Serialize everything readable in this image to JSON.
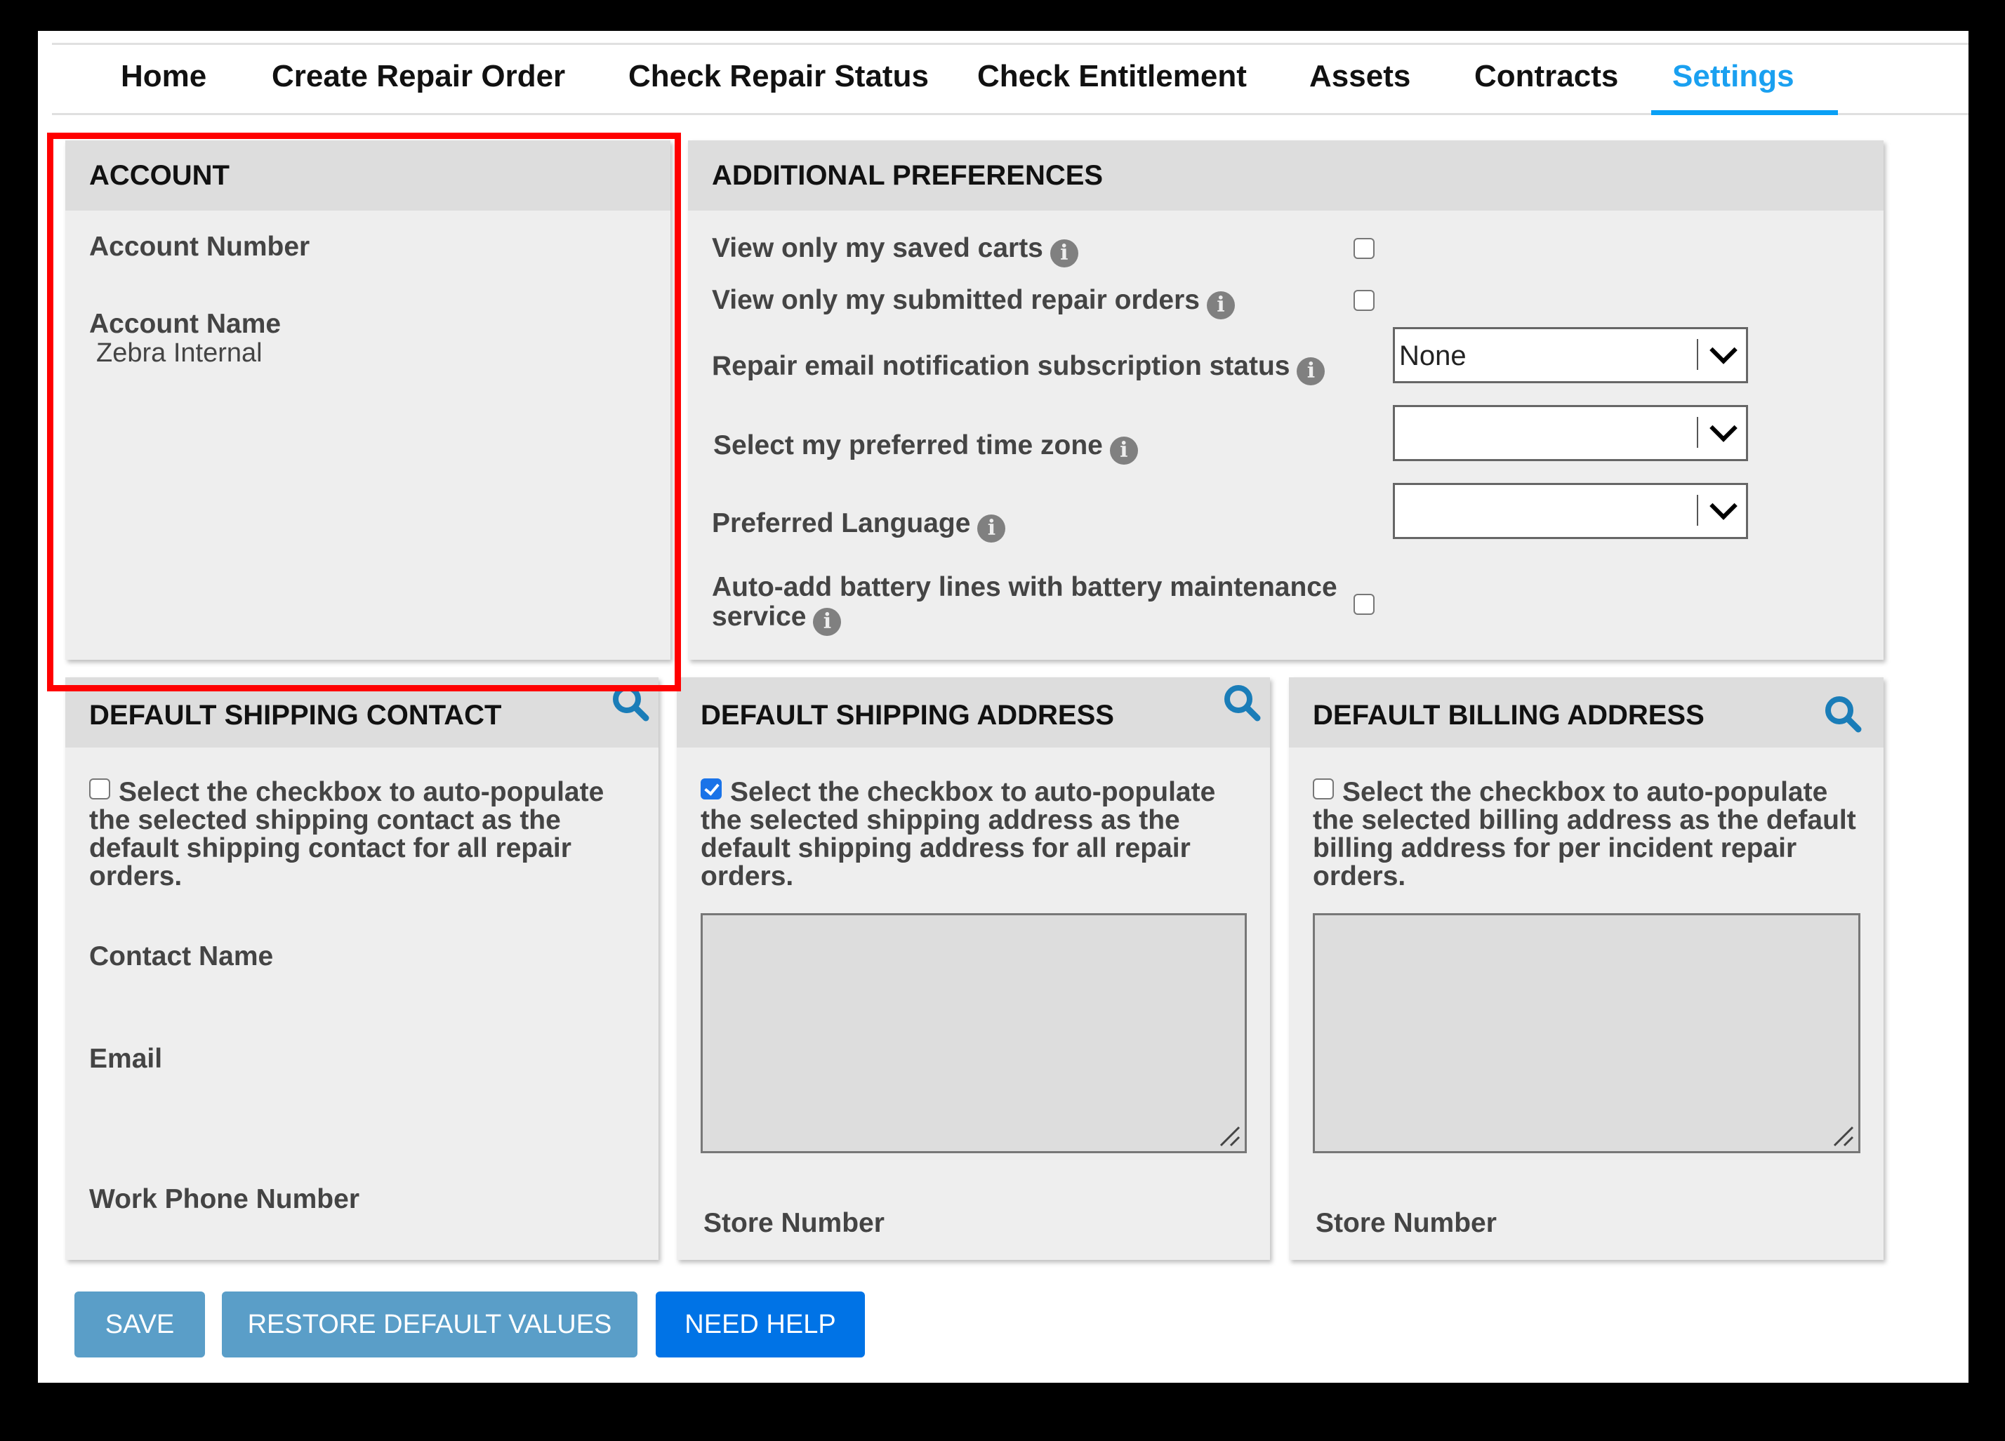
{
  "nav": {
    "tabs": [
      {
        "label": "Home",
        "active": false
      },
      {
        "label": "Create Repair Order",
        "active": false
      },
      {
        "label": "Check Repair Status",
        "active": false
      },
      {
        "label": "Check Entitlement",
        "active": false
      },
      {
        "label": "Assets",
        "active": false
      },
      {
        "label": "Contracts",
        "active": false
      },
      {
        "label": "Settings",
        "active": true
      }
    ]
  },
  "account": {
    "title": "ACCOUNT",
    "account_number_label": "Account Number",
    "account_number_value": "",
    "account_name_label": "Account Name",
    "account_name_value": "Zebra Internal",
    "highlighted": true
  },
  "preferences": {
    "title": "ADDITIONAL PREFERENCES",
    "saved_carts_label": "View only my saved carts",
    "saved_carts_checked": false,
    "submitted_orders_label": "View only my submitted repair orders",
    "submitted_orders_checked": false,
    "email_notification_label": "Repair email notification subscription status",
    "email_notification_value": "None",
    "time_zone_label": "Select my preferred time zone",
    "time_zone_value": "",
    "language_label": "Preferred Language",
    "language_value": "",
    "battery_label_line1": "Auto-add battery lines with battery maintenance",
    "battery_label_line2": "service",
    "battery_checked": false,
    "info_glyph": "i"
  },
  "shipping_contact": {
    "title": "DEFAULT SHIPPING CONTACT",
    "description": "Select the checkbox to auto-populate the selected shipping contact as the default shipping contact for all repair orders.",
    "checked": false,
    "contact_name_label": "Contact Name",
    "email_label": "Email",
    "work_phone_label": "Work Phone Number"
  },
  "shipping_address": {
    "title": "DEFAULT SHIPPING ADDRESS",
    "description": "Select the checkbox to auto-populate the selected shipping address as the default shipping address for all repair orders.",
    "checked": true,
    "address_value": "",
    "store_number_label": "Store Number"
  },
  "billing_address": {
    "title": "DEFAULT BILLING ADDRESS",
    "description": "Select the checkbox to auto-populate the selected billing address as the default billing address for per incident repair orders.",
    "checked": false,
    "address_value": "",
    "store_number_label": "Store Number"
  },
  "buttons": {
    "save": "SAVE",
    "restore": "RESTORE DEFAULT VALUES",
    "help": "NEED HELP"
  },
  "colors": {
    "active_tab": "#1aa0f0",
    "highlight_box": "#ff0000",
    "search_icon": "#1a7db8",
    "muted_button": "#5a9ec8",
    "primary_button": "#0073e6"
  }
}
